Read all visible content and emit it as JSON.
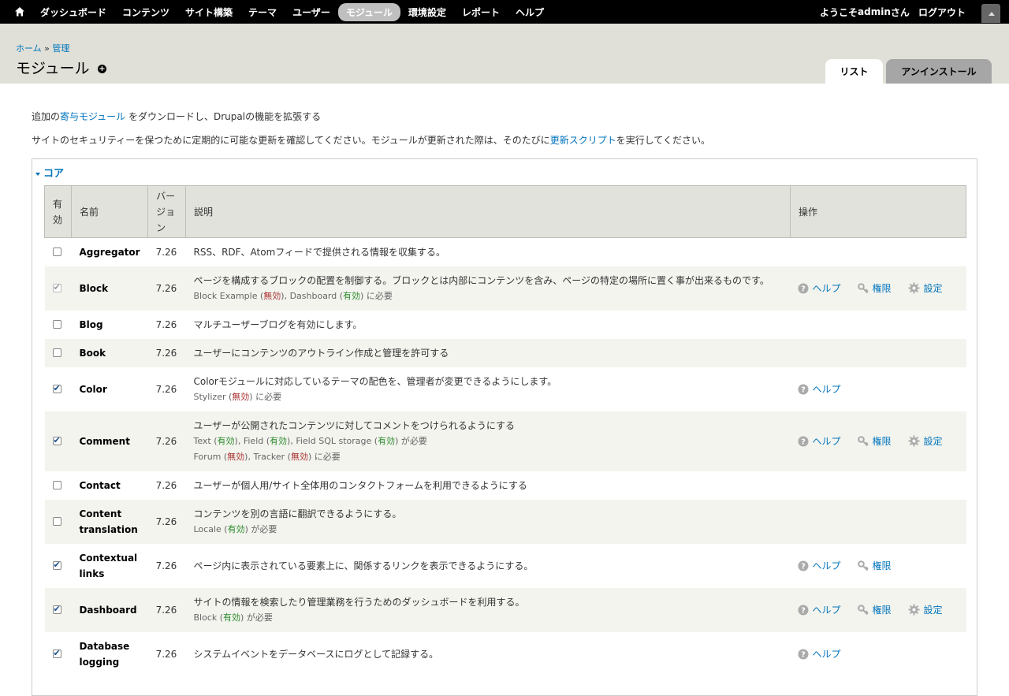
{
  "toolbar": {
    "menu": [
      "ダッシュボード",
      "コンテンツ",
      "サイト構築",
      "テーマ",
      "ユーザー",
      "モジュール",
      "環境設定",
      "レポート",
      "ヘルプ"
    ],
    "active": "モジュール",
    "welcome_prefix": "ようこそ ",
    "username": "admin",
    "welcome_suffix": "さん",
    "logout": "ログアウト"
  },
  "header": {
    "breadcrumb": [
      "ホーム",
      "管理"
    ],
    "breadcrumb_sep": "»",
    "title": "モジュール",
    "tabs": [
      "リスト",
      "アンインストール"
    ]
  },
  "intro": {
    "line1_a": "追加の",
    "line1_link": "寄与モジュール",
    "line1_b": " をダウンロードし、Drupalの機能を拡張する",
    "line2_a": "サイトのセキュリティーを保つために定期的に可能な更新を確認してください。モジュールが更新された際は、そのたびに",
    "line2_link": "更新スクリプト",
    "line2_b": "を実行してください。"
  },
  "fieldset": {
    "legend": "コア"
  },
  "table": {
    "headers": {
      "enabled": [
        "有",
        "効"
      ],
      "name": "名前",
      "version": [
        "バー",
        "ジョ",
        "ン"
      ],
      "description": "説明",
      "operations": "操作"
    },
    "ops_labels": {
      "help": "ヘルプ",
      "permissions": "権限",
      "configure": "設定"
    },
    "status_labels": {
      "enabled": "有効",
      "disabled": "無効"
    },
    "rows": [
      {
        "name": [
          "Aggregator"
        ],
        "version": "7.26",
        "checked": false,
        "disabled": false,
        "description": "RSS、RDF、Atomフィードで提供される情報を収集する。",
        "reqs": [],
        "ops": []
      },
      {
        "name": [
          "Block"
        ],
        "version": "7.26",
        "checked": true,
        "disabled": true,
        "description": "ページを構成するブロックの配置を制御する。ブロックとは内部にコンテンツを含み、ページの特定の場所に置く事が出来るものです。",
        "reqs": [
          {
            "items": [
              {
                "n": "Block Example",
                "s": "disabled"
              },
              {
                "n": "Dashboard",
                "s": "enabled"
              }
            ],
            "suffix": " に必要"
          }
        ],
        "ops": [
          "help",
          "permissions",
          "configure"
        ]
      },
      {
        "name": [
          "Blog"
        ],
        "version": "7.26",
        "checked": false,
        "disabled": false,
        "description": "マルチユーザーブログを有効にします。",
        "reqs": [],
        "ops": []
      },
      {
        "name": [
          "Book"
        ],
        "version": "7.26",
        "checked": false,
        "disabled": false,
        "description": "ユーザーにコンテンツのアウトライン作成と管理を許可する",
        "reqs": [],
        "ops": []
      },
      {
        "name": [
          "Color"
        ],
        "version": "7.26",
        "checked": true,
        "disabled": false,
        "description": "Colorモジュールに対応しているテーマの配色を、管理者が変更できるようにします。",
        "reqs": [
          {
            "items": [
              {
                "n": "Stylizer",
                "s": "disabled"
              }
            ],
            "suffix": " に必要"
          }
        ],
        "ops": [
          "help"
        ]
      },
      {
        "name": [
          "Comment"
        ],
        "version": "7.26",
        "checked": true,
        "disabled": false,
        "description": "ユーザーが公開されたコンテンツに対してコメントをつけられるようにする",
        "reqs": [
          {
            "items": [
              {
                "n": "Text",
                "s": "enabled"
              },
              {
                "n": "Field",
                "s": "enabled"
              },
              {
                "n": "Field SQL storage",
                "s": "enabled"
              }
            ],
            "suffix": " が必要"
          },
          {
            "items": [
              {
                "n": "Forum",
                "s": "disabled"
              },
              {
                "n": "Tracker",
                "s": "disabled"
              }
            ],
            "suffix": " に必要"
          }
        ],
        "ops": [
          "help",
          "permissions",
          "configure"
        ]
      },
      {
        "name": [
          "Contact"
        ],
        "version": "7.26",
        "checked": false,
        "disabled": false,
        "description": "ユーザーが個人用/サイト全体用のコンタクトフォームを利用できるようにする",
        "reqs": [],
        "ops": []
      },
      {
        "name": [
          "Content",
          "translation"
        ],
        "version": "7.26",
        "checked": false,
        "disabled": false,
        "description": "コンテンツを別の言語に翻訳できるようにする。",
        "reqs": [
          {
            "items": [
              {
                "n": "Locale",
                "s": "enabled"
              }
            ],
            "suffix": " が必要"
          }
        ],
        "ops": []
      },
      {
        "name": [
          "Contextual",
          "links"
        ],
        "version": "7.26",
        "checked": true,
        "disabled": false,
        "description": "ページ内に表示されている要素上に、関係するリンクを表示できるようにする。",
        "reqs": [],
        "ops": [
          "help",
          "permissions"
        ]
      },
      {
        "name": [
          "Dashboard"
        ],
        "version": "7.26",
        "checked": true,
        "disabled": false,
        "description": "サイトの情報を検索したり管理業務を行うためのダッシュボードを利用する。",
        "reqs": [
          {
            "items": [
              {
                "n": "Block",
                "s": "enabled"
              }
            ],
            "suffix": " が必要"
          }
        ],
        "ops": [
          "help",
          "permissions",
          "configure"
        ]
      },
      {
        "name": [
          "Database",
          "logging"
        ],
        "version": "7.26",
        "checked": true,
        "disabled": false,
        "description": "システムイベントをデータベースにログとして記録する。",
        "reqs": [],
        "ops": [
          "help"
        ]
      }
    ]
  }
}
